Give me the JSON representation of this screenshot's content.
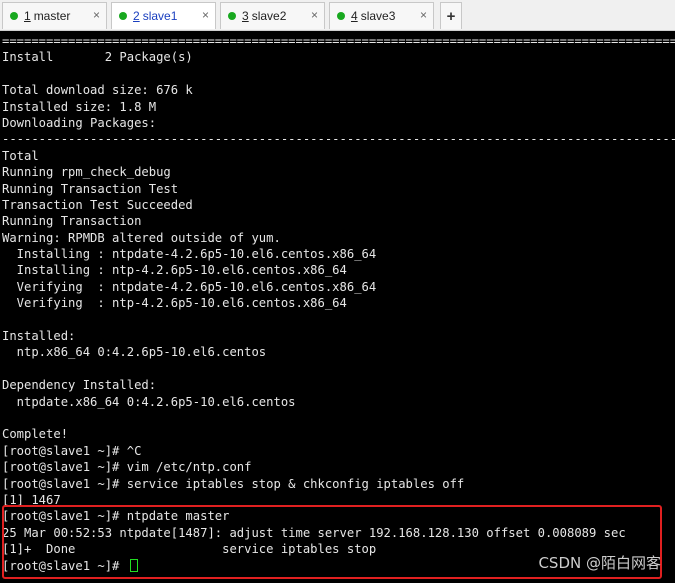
{
  "tabs": [
    {
      "num": "1",
      "label": "master",
      "active": false
    },
    {
      "num": "2",
      "label": "slave1",
      "active": true
    },
    {
      "num": "3",
      "label": "slave2",
      "active": false
    },
    {
      "num": "4",
      "label": "slave3",
      "active": false
    }
  ],
  "tab_close_glyph": "×",
  "add_tab_glyph": "+",
  "terminal": {
    "lines": [
      "================================================================================================",
      "Install       2 Package(s)",
      "",
      "Total download size: 676 k",
      "Installed size: 1.8 M",
      "Downloading Packages:",
      "------------------------------------------------------------------------------------------------",
      "Total",
      "Running rpm_check_debug",
      "Running Transaction Test",
      "Transaction Test Succeeded",
      "Running Transaction",
      "Warning: RPMDB altered outside of yum.",
      "  Installing : ntpdate-4.2.6p5-10.el6.centos.x86_64",
      "  Installing : ntp-4.2.6p5-10.el6.centos.x86_64",
      "  Verifying  : ntpdate-4.2.6p5-10.el6.centos.x86_64",
      "  Verifying  : ntp-4.2.6p5-10.el6.centos.x86_64",
      "",
      "Installed:",
      "  ntp.x86_64 0:4.2.6p5-10.el6.centos",
      "",
      "Dependency Installed:",
      "  ntpdate.x86_64 0:4.2.6p5-10.el6.centos",
      "",
      "Complete!",
      "[root@slave1 ~]# ^C",
      "[root@slave1 ~]# vim /etc/ntp.conf",
      "[root@slave1 ~]# service iptables stop & chkconfig iptables off",
      "[1] 1467",
      "[root@slave1 ~]# ntpdate master",
      "25 Mar 00:52:53 ntpdate[1487]: adjust time server 192.168.128.130 offset 0.008089 sec",
      "[1]+  Done                    service iptables stop",
      "[root@slave1 ~]# "
    ]
  },
  "watermark": "CSDN @陌白网客",
  "colors": {
    "terminal_bg": "#000000",
    "terminal_fg": "#e6e6e6",
    "tab_status": "#18a81f",
    "highlight_border": "#e02020",
    "cursor": "#22dd22"
  }
}
